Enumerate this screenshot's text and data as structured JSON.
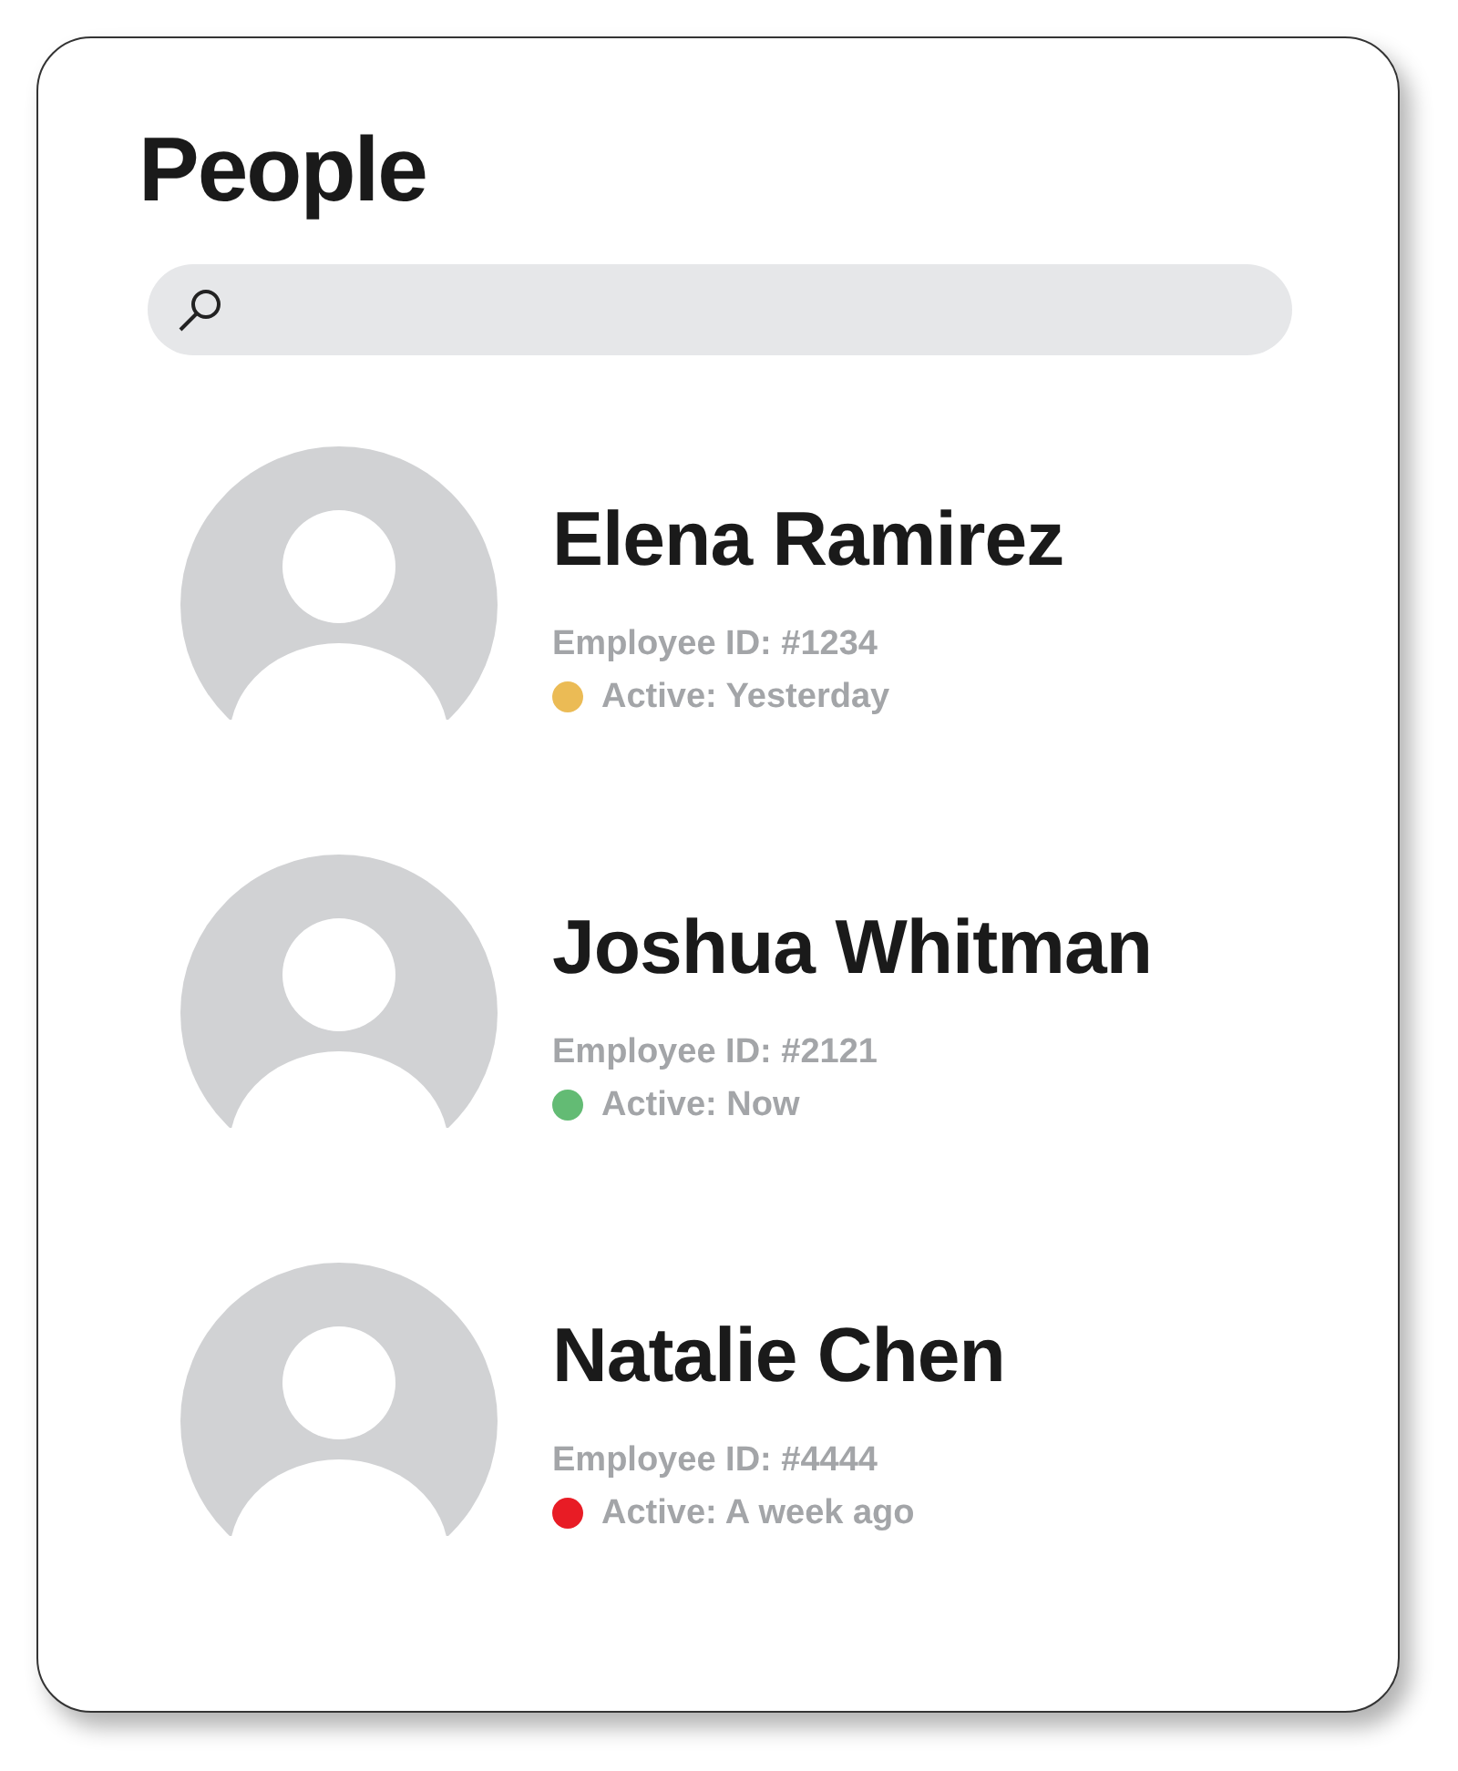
{
  "title": "People",
  "people": [
    {
      "name": "Elena Ramirez",
      "employee_id": "Employee ID: #1234",
      "status": "Active: Yesterday",
      "color": "#ebbb55"
    },
    {
      "name": "Joshua Whitman",
      "employee_id": "Employee ID: #2121",
      "status": "Active: Now",
      "color": "#63bb74"
    },
    {
      "name": "Natalie Chen",
      "employee_id": "Employee ID: #4444",
      "status": "Active: A week ago",
      "color": "#e81c25"
    }
  ]
}
